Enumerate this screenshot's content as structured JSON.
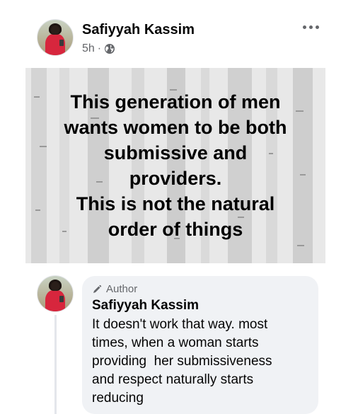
{
  "post": {
    "author_name": "Safiyyah Kassim",
    "time": "5h",
    "separator": "·",
    "audience_icon": "globe-icon",
    "more_icon": "more-options-icon",
    "caption_lines": [
      "This generation of men",
      "wants women to be both",
      "submissive and",
      "providers.",
      "This is not the natural",
      "order of things"
    ]
  },
  "comment": {
    "badge_icon": "pencil-icon",
    "badge_label": "Author",
    "author_name": "Safiyyah Kassim",
    "text_lines": [
      "It doesn't work that way. most",
      "times, when a woman starts",
      "providing  her submissiveness",
      "and respect naturally starts",
      "reducing"
    ]
  },
  "colors": {
    "secondary_text": "#65676b",
    "bubble_bg": "#f0f2f5",
    "avatar_shirt": "#d7263d"
  }
}
